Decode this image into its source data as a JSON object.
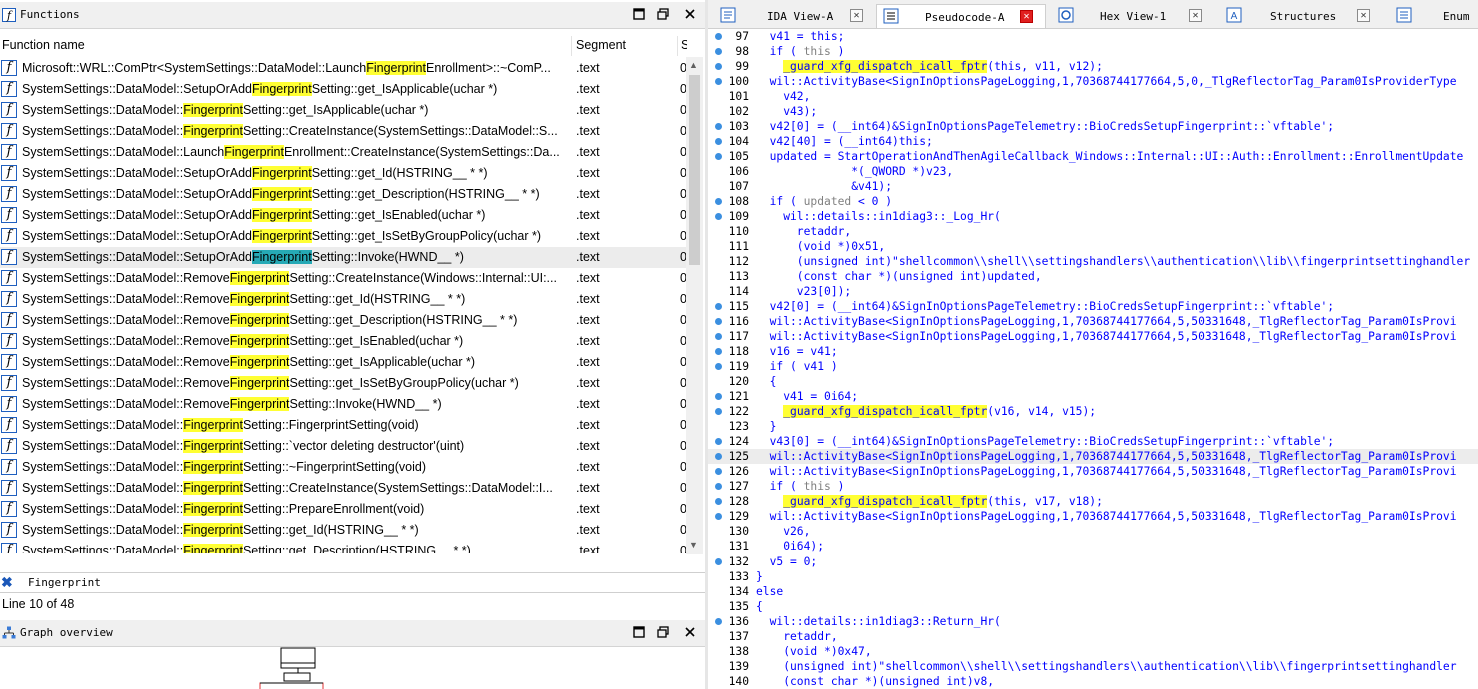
{
  "functions_panel": {
    "title": "Functions",
    "columns": {
      "name": "Function name",
      "segment": "Segment",
      "third": "S"
    },
    "rows": [
      {
        "pre": "Microsoft::WRL::ComPtr<SystemSettings::DataModel::Launch",
        "hit": "Fingerprint",
        "post": "Enrollment>::~ComP...",
        "seg": ".text",
        "cut": "0"
      },
      {
        "pre": "SystemSettings::DataModel::SetupOrAdd",
        "hit": "Fingerprint",
        "post": "Setting::get_IsApplicable(uchar *)",
        "seg": ".text",
        "cut": "0"
      },
      {
        "pre": "SystemSettings::DataModel::",
        "hit": "Fingerprint",
        "post": "Setting::get_IsApplicable(uchar *)",
        "seg": ".text",
        "cut": "0"
      },
      {
        "pre": "SystemSettings::DataModel::",
        "hit": "Fingerprint",
        "post": "Setting::CreateInstance(SystemSettings::DataModel::S...",
        "seg": ".text",
        "cut": "0"
      },
      {
        "pre": "SystemSettings::DataModel::Launch",
        "hit": "Fingerprint",
        "post": "Enrollment::CreateInstance(SystemSettings::Da...",
        "seg": ".text",
        "cut": "0"
      },
      {
        "pre": "SystemSettings::DataModel::SetupOrAdd",
        "hit": "Fingerprint",
        "post": "Setting::get_Id(HSTRING__ * *)",
        "seg": ".text",
        "cut": "0"
      },
      {
        "pre": "SystemSettings::DataModel::SetupOrAdd",
        "hit": "Fingerprint",
        "post": "Setting::get_Description(HSTRING__ * *)",
        "seg": ".text",
        "cut": "0"
      },
      {
        "pre": "SystemSettings::DataModel::SetupOrAdd",
        "hit": "Fingerprint",
        "post": "Setting::get_IsEnabled(uchar *)",
        "seg": ".text",
        "cut": "0"
      },
      {
        "pre": "SystemSettings::DataModel::SetupOrAdd",
        "hit": "Fingerprint",
        "post": "Setting::get_IsSetByGroupPolicy(uchar *)",
        "seg": ".text",
        "cut": "0"
      },
      {
        "pre": "SystemSettings::DataModel::SetupOrAdd",
        "hit": "Fingerprint",
        "post": "Setting::Invoke(HWND__ *)",
        "seg": ".text",
        "cut": "0",
        "selected": true
      },
      {
        "pre": "SystemSettings::DataModel::Remove",
        "hit": "Fingerprint",
        "post": "Setting::CreateInstance(Windows::Internal::UI:...",
        "seg": ".text",
        "cut": "0"
      },
      {
        "pre": "SystemSettings::DataModel::Remove",
        "hit": "Fingerprint",
        "post": "Setting::get_Id(HSTRING__ * *)",
        "seg": ".text",
        "cut": "0"
      },
      {
        "pre": "SystemSettings::DataModel::Remove",
        "hit": "Fingerprint",
        "post": "Setting::get_Description(HSTRING__ * *)",
        "seg": ".text",
        "cut": "0"
      },
      {
        "pre": "SystemSettings::DataModel::Remove",
        "hit": "Fingerprint",
        "post": "Setting::get_IsEnabled(uchar *)",
        "seg": ".text",
        "cut": "0"
      },
      {
        "pre": "SystemSettings::DataModel::Remove",
        "hit": "Fingerprint",
        "post": "Setting::get_IsApplicable(uchar *)",
        "seg": ".text",
        "cut": "0"
      },
      {
        "pre": "SystemSettings::DataModel::Remove",
        "hit": "Fingerprint",
        "post": "Setting::get_IsSetByGroupPolicy(uchar *)",
        "seg": ".text",
        "cut": "0"
      },
      {
        "pre": "SystemSettings::DataModel::Remove",
        "hit": "Fingerprint",
        "post": "Setting::Invoke(HWND__ *)",
        "seg": ".text",
        "cut": "0"
      },
      {
        "pre": "SystemSettings::DataModel::",
        "hit": "Fingerprint",
        "post": "Setting::FingerprintSetting(void)",
        "seg": ".text",
        "cut": "0"
      },
      {
        "pre": "SystemSettings::DataModel::",
        "hit": "Fingerprint",
        "post": "Setting::`vector deleting destructor'(uint)",
        "seg": ".text",
        "cut": "0"
      },
      {
        "pre": "SystemSettings::DataModel::",
        "hit": "Fingerprint",
        "post": "Setting::~FingerprintSetting(void)",
        "seg": ".text",
        "cut": "0"
      },
      {
        "pre": "SystemSettings::DataModel::",
        "hit": "Fingerprint",
        "post": "Setting::CreateInstance(SystemSettings::DataModel::I...",
        "seg": ".text",
        "cut": "0"
      },
      {
        "pre": "SystemSettings::DataModel::",
        "hit": "Fingerprint",
        "post": "Setting::PrepareEnrollment(void)",
        "seg": ".text",
        "cut": "0"
      },
      {
        "pre": "SystemSettings::DataModel::",
        "hit": "Fingerprint",
        "post": "Setting::get_Id(HSTRING__ * *)",
        "seg": ".text",
        "cut": "0"
      },
      {
        "pre": "SystemSettings::DataModel::",
        "hit": "Fingerprint",
        "post": "Setting::get_Description(HSTRING__ * *)",
        "seg": ".text",
        "cut": "0"
      }
    ],
    "filter_value": "Fingerprint",
    "status": "Line 10 of 48"
  },
  "graph_panel": {
    "title": "Graph overview"
  },
  "tabs": [
    {
      "label": "IDA View-A",
      "icon": "ida-view-icon"
    },
    {
      "label": "Pseudocode-A",
      "icon": "pseudocode-icon",
      "active": true
    },
    {
      "label": "Hex View-1",
      "icon": "hex-view-icon"
    },
    {
      "label": "Structures",
      "icon": "structures-icon"
    },
    {
      "label": "Enum",
      "icon": "enums-icon"
    }
  ],
  "code": [
    {
      "n": "97",
      "dot": true,
      "seg": [
        [
          "t",
          "  v41 = this;"
        ]
      ]
    },
    {
      "n": "98",
      "dot": true,
      "seg": [
        [
          "t",
          "  if ( "
        ],
        [
          "g",
          "this"
        ],
        [
          "t",
          " )"
        ]
      ]
    },
    {
      "n": "99",
      "dot": true,
      "seg": [
        [
          "t",
          "    "
        ],
        [
          "y",
          "_guard_xfg_dispatch_icall_fptr"
        ],
        [
          "t",
          "(this, v11, v12);"
        ]
      ]
    },
    {
      "n": "100",
      "dot": true,
      "seg": [
        [
          "t",
          "  wil::ActivityBase<SignInOptionsPageLogging,1,70368744177664,5,0,_TlgReflectorTag_Param0IsProviderType"
        ]
      ]
    },
    {
      "n": "101",
      "dot": false,
      "seg": [
        [
          "t",
          "    v42,"
        ]
      ]
    },
    {
      "n": "102",
      "dot": false,
      "seg": [
        [
          "t",
          "    v43);"
        ]
      ]
    },
    {
      "n": "103",
      "dot": true,
      "seg": [
        [
          "t",
          "  v42[0] = (__int64)&SignInOptionsPageTelemetry::BioCredsSetupFingerprint::`vftable';"
        ]
      ]
    },
    {
      "n": "104",
      "dot": true,
      "seg": [
        [
          "t",
          "  v42[40] = (__int64)this;"
        ]
      ]
    },
    {
      "n": "105",
      "dot": true,
      "seg": [
        [
          "t",
          "  updated = StartOperationAndThenAgileCallback_Windows::Internal::UI::Auth::Enrollment::EnrollmentUpdate"
        ]
      ]
    },
    {
      "n": "106",
      "dot": false,
      "seg": [
        [
          "t",
          "              *(_QWORD *)v23,"
        ]
      ]
    },
    {
      "n": "107",
      "dot": false,
      "seg": [
        [
          "t",
          "              &v41);"
        ]
      ]
    },
    {
      "n": "108",
      "dot": true,
      "seg": [
        [
          "t",
          "  if ( "
        ],
        [
          "g",
          "updated"
        ],
        [
          "t",
          " < 0 )"
        ]
      ]
    },
    {
      "n": "109",
      "dot": true,
      "seg": [
        [
          "t",
          "    wil::details::in1diag3::_Log_Hr("
        ]
      ]
    },
    {
      "n": "110",
      "dot": false,
      "seg": [
        [
          "t",
          "      retaddr,"
        ]
      ]
    },
    {
      "n": "111",
      "dot": false,
      "seg": [
        [
          "t",
          "      (void *)0x51,"
        ]
      ]
    },
    {
      "n": "112",
      "dot": false,
      "seg": [
        [
          "t",
          "      (unsigned int)\"shellcommon\\\\shell\\\\settingshandlers\\\\authentication\\\\lib\\\\fingerprintsettinghandler"
        ]
      ]
    },
    {
      "n": "113",
      "dot": false,
      "seg": [
        [
          "t",
          "      (const char *)(unsigned int)updated,"
        ]
      ]
    },
    {
      "n": "114",
      "dot": false,
      "seg": [
        [
          "t",
          "      v23[0]);"
        ]
      ]
    },
    {
      "n": "115",
      "dot": true,
      "seg": [
        [
          "t",
          "  v42[0] = (__int64)&SignInOptionsPageTelemetry::BioCredsSetupFingerprint::`vftable';"
        ]
      ]
    },
    {
      "n": "116",
      "dot": true,
      "seg": [
        [
          "t",
          "  wil::ActivityBase<SignInOptionsPageLogging,1,70368744177664,5,50331648,_TlgReflectorTag_Param0IsProvi"
        ]
      ]
    },
    {
      "n": "117",
      "dot": true,
      "seg": [
        [
          "t",
          "  wil::ActivityBase<SignInOptionsPageLogging,1,70368744177664,5,50331648,_TlgReflectorTag_Param0IsProvi"
        ]
      ]
    },
    {
      "n": "118",
      "dot": true,
      "seg": [
        [
          "t",
          "  v16 = v41;"
        ]
      ]
    },
    {
      "n": "119",
      "dot": true,
      "seg": [
        [
          "t",
          "  if ( v41 )"
        ]
      ]
    },
    {
      "n": "120",
      "dot": false,
      "seg": [
        [
          "t",
          "  {"
        ]
      ]
    },
    {
      "n": "121",
      "dot": true,
      "seg": [
        [
          "t",
          "    v41 = 0i64;"
        ]
      ]
    },
    {
      "n": "122",
      "dot": true,
      "seg": [
        [
          "t",
          "    "
        ],
        [
          "y",
          "_guard_xfg_dispatch_icall_fptr"
        ],
        [
          "t",
          "(v16, v14, v15);"
        ]
      ]
    },
    {
      "n": "123",
      "dot": false,
      "seg": [
        [
          "t",
          "  }"
        ]
      ]
    },
    {
      "n": "124",
      "dot": true,
      "seg": [
        [
          "t",
          "  v43[0] = (__int64)&SignInOptionsPageTelemetry::BioCredsSetupFingerprint::`vftable';"
        ]
      ]
    },
    {
      "n": "125",
      "dot": true,
      "hl": true,
      "seg": [
        [
          "t",
          "  wil::ActivityBase<SignInOptionsPageLogging,1,70368744177664,5,50331648,_TlgReflectorTag_Param0IsProvi"
        ]
      ]
    },
    {
      "n": "126",
      "dot": true,
      "seg": [
        [
          "t",
          "  wil::ActivityBase<SignInOptionsPageLogging,1,70368744177664,5,50331648,_TlgReflectorTag_Param0IsProvi"
        ]
      ]
    },
    {
      "n": "127",
      "dot": true,
      "seg": [
        [
          "t",
          "  if ( "
        ],
        [
          "g",
          "this"
        ],
        [
          "t",
          " )"
        ]
      ]
    },
    {
      "n": "128",
      "dot": true,
      "seg": [
        [
          "t",
          "    "
        ],
        [
          "y",
          "_guard_xfg_dispatch_icall_fptr"
        ],
        [
          "t",
          "(this, v17, v18);"
        ]
      ]
    },
    {
      "n": "129",
      "dot": true,
      "seg": [
        [
          "t",
          "  wil::ActivityBase<SignInOptionsPageLogging,1,70368744177664,5,50331648,_TlgReflectorTag_Param0IsProvi"
        ]
      ]
    },
    {
      "n": "130",
      "dot": false,
      "seg": [
        [
          "t",
          "    v26,"
        ]
      ]
    },
    {
      "n": "131",
      "dot": false,
      "seg": [
        [
          "t",
          "    0i64);"
        ]
      ]
    },
    {
      "n": "132",
      "dot": true,
      "seg": [
        [
          "t",
          "  v5 = 0;"
        ]
      ]
    },
    {
      "n": "133",
      "dot": false,
      "seg": [
        [
          "t",
          "}"
        ]
      ]
    },
    {
      "n": "134",
      "dot": false,
      "seg": [
        [
          "t",
          "else"
        ]
      ]
    },
    {
      "n": "135",
      "dot": false,
      "seg": [
        [
          "t",
          "{"
        ]
      ]
    },
    {
      "n": "136",
      "dot": true,
      "seg": [
        [
          "t",
          "  wil::details::in1diag3::Return_Hr("
        ]
      ]
    },
    {
      "n": "137",
      "dot": false,
      "seg": [
        [
          "t",
          "    retaddr,"
        ]
      ]
    },
    {
      "n": "138",
      "dot": false,
      "seg": [
        [
          "t",
          "    (void *)0x47,"
        ]
      ]
    },
    {
      "n": "139",
      "dot": false,
      "seg": [
        [
          "t",
          "    (unsigned int)\"shellcommon\\\\shell\\\\settingshandlers\\\\authentication\\\\lib\\\\fingerprintsettinghandler"
        ]
      ]
    },
    {
      "n": "140",
      "dot": false,
      "seg": [
        [
          "t",
          "    (const char *)(unsigned int)v8,"
        ]
      ]
    }
  ]
}
